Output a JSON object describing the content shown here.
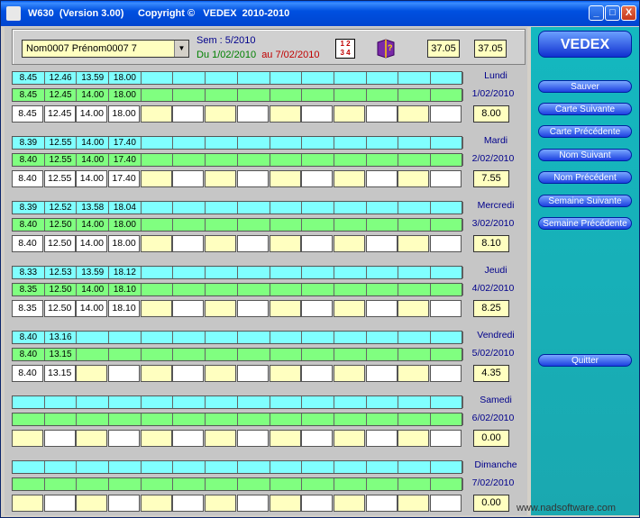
{
  "window": {
    "title": "W630  (Version 3.00)",
    "copyright": "Copyright ©   VEDEX  2010-2010",
    "minimize": "_",
    "maximize": "□",
    "close": "X"
  },
  "header": {
    "employee_select": "Nom0007 Prénom0007 7",
    "week": "Sem : 5/2010",
    "from_label": "Du",
    "from_date": "1/02/2010",
    "to_label": "au",
    "to_date": "7/02/2010",
    "total_1": "37.05",
    "total_2": "37.05"
  },
  "days": [
    {
      "name": "Lundi",
      "date": "1/02/2010",
      "total": "8.00",
      "row1": [
        "8.45",
        "12.46",
        "13.59",
        "18.00"
      ],
      "row2": [
        "8.45",
        "12.45",
        "14.00",
        "18.00"
      ],
      "row3": [
        "8.45",
        "12.45",
        "14.00",
        "18.00"
      ]
    },
    {
      "name": "Mardi",
      "date": "2/02/2010",
      "total": "7.55",
      "row1": [
        "8.39",
        "12.55",
        "14.00",
        "17.40"
      ],
      "row2": [
        "8.40",
        "12.55",
        "14.00",
        "17.40"
      ],
      "row3": [
        "8.40",
        "12.55",
        "14.00",
        "17.40"
      ]
    },
    {
      "name": "Mercredi",
      "date": "3/02/2010",
      "total": "8.10",
      "row1": [
        "8.39",
        "12.52",
        "13.58",
        "18.04"
      ],
      "row2": [
        "8.40",
        "12.50",
        "14.00",
        "18.00"
      ],
      "row3": [
        "8.40",
        "12.50",
        "14.00",
        "18.00"
      ]
    },
    {
      "name": "Jeudi",
      "date": "4/02/2010",
      "total": "8.25",
      "row1": [
        "8.33",
        "12.53",
        "13.59",
        "18.12"
      ],
      "row2": [
        "8.35",
        "12.50",
        "14.00",
        "18.10"
      ],
      "row3": [
        "8.35",
        "12.50",
        "14.00",
        "18.10"
      ]
    },
    {
      "name": "Vendredi",
      "date": "5/02/2010",
      "total": "4.35",
      "row1": [
        "8.40",
        "13.16",
        "",
        ""
      ],
      "row2": [
        "8.40",
        "13.15",
        "",
        ""
      ],
      "row3": [
        "8.40",
        "13.15",
        "",
        ""
      ]
    },
    {
      "name": "Samedi",
      "date": "6/02/2010",
      "total": "0.00",
      "row1": [
        "",
        "",
        "",
        ""
      ],
      "row2": [
        "",
        "",
        "",
        ""
      ],
      "row3": [
        "",
        "",
        "",
        ""
      ]
    },
    {
      "name": "Dimanche",
      "date": "7/02/2010",
      "total": "0.00",
      "row1": [
        "",
        "",
        "",
        ""
      ],
      "row2": [
        "",
        "",
        "",
        ""
      ],
      "row3": [
        "",
        "",
        "",
        ""
      ]
    }
  ],
  "sidebar": {
    "brand": "VEDEX",
    "buttons": [
      "Sauver",
      "Carte Suivante",
      "Carte Précédente",
      "Nom Suivant",
      "Nom Précédent",
      "Semaine Suivante",
      "Semaine Précédente"
    ],
    "quit": "Quitter"
  },
  "footer": {
    "website": "www.nadsoftware.com"
  },
  "colors": {
    "row_cyan": "#80ffff",
    "row_green": "#80ff80",
    "input_yellow": "#ffffc0",
    "sidebar": "#1aa8b0"
  }
}
